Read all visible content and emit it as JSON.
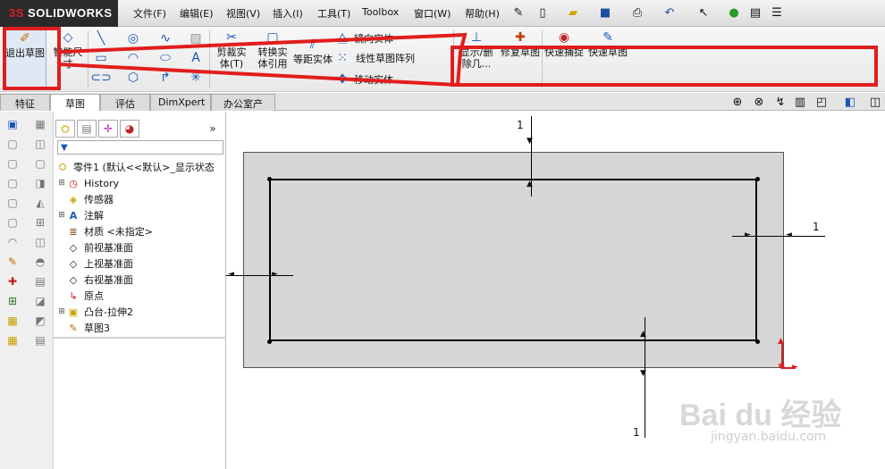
{
  "app": {
    "logo_text_prefix": "3S",
    "logo_text": "SOLIDWORKS"
  },
  "menu": [
    "文件(F)",
    "编辑(E)",
    "视图(V)",
    "插入(I)",
    "工具(T)",
    "Toolbox",
    "窗口(W)",
    "帮助(H)"
  ],
  "ribbon": {
    "exit_sketch": "退出草图",
    "smart_dim": "智能尺寸",
    "trim": "剪裁实体(T)",
    "convert": "转换实体引用",
    "offset": "等距实体",
    "mirror": "镜向实体",
    "linear_pattern": "线性草图阵列",
    "move": "移动实体",
    "display_delete": "显示/删除几...",
    "repair": "修复草图",
    "quick_snap": "快速捕捉",
    "rapid_sketch": "快速草图"
  },
  "tabs": [
    "特征",
    "草图",
    "评估",
    "DimXpert",
    "办公室产品"
  ],
  "active_tab": "草图",
  "tree": {
    "root": "零件1 (默认<<默认>_显示状态",
    "items": [
      "History",
      "传感器",
      "注解",
      "材质 <未指定>",
      "前视基准面",
      "上视基准面",
      "右视基准面",
      "原点",
      "凸台-拉伸2",
      "草图3"
    ]
  },
  "dims": {
    "top": "1",
    "right": "1",
    "bottom": "1"
  },
  "watermark": {
    "text": "Bai du 经验",
    "url": "jingyan.baidu.com"
  },
  "colors": {
    "highlight": "#e11d1d",
    "sketch_face": "#d6d6d6"
  }
}
